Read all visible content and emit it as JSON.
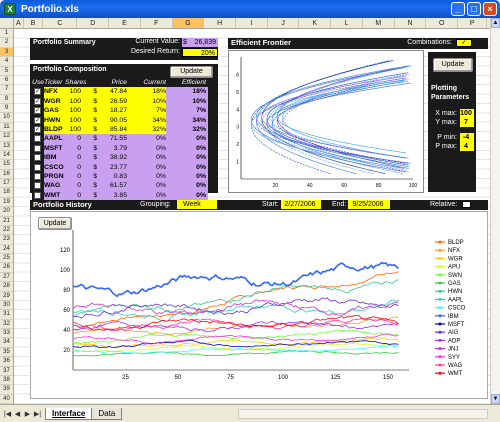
{
  "window": {
    "title": "Portfolio.xls"
  },
  "columns": [
    "A",
    "B",
    "C",
    "D",
    "E",
    "F",
    "G",
    "H",
    "I",
    "J",
    "K",
    "L",
    "M",
    "N",
    "O",
    "P"
  ],
  "selected_column": "G",
  "rows": [
    "1",
    "2",
    "3",
    "4",
    "5",
    "6",
    "7",
    "8",
    "9",
    "10",
    "11",
    "12",
    "13",
    "14",
    "15",
    "16",
    "17",
    "18",
    "19",
    "20",
    "21",
    "22",
    "23",
    "24",
    "25",
    "26",
    "27",
    "28",
    "29",
    "30",
    "31",
    "32",
    "33",
    "34",
    "35",
    "36",
    "37",
    "38",
    "39",
    "40"
  ],
  "selected_row": "3",
  "summary": {
    "title": "Portfolio Summary",
    "current_value_label": "Current Value:",
    "current_value_currency": "$",
    "current_value": "26,839",
    "desired_return_label": "Desired Return:",
    "desired_return": "20%"
  },
  "composition": {
    "title": "Portfolio Composition",
    "update_label": "Update",
    "headers": {
      "use": "Use",
      "ticker": "Ticker",
      "shares": "Shares",
      "price": "Price",
      "current": "Current",
      "efficient": "Efficient"
    },
    "rows": [
      {
        "checked": true,
        "ticker": "NFX",
        "shares": "100",
        "dollar": "$",
        "price": "47.84",
        "current": "18%",
        "efficient": "18%",
        "highlight": true
      },
      {
        "checked": true,
        "ticker": "WGR",
        "shares": "100",
        "dollar": "$",
        "price": "26.59",
        "current": "10%",
        "efficient": "10%",
        "highlight": true
      },
      {
        "checked": true,
        "ticker": "GAS",
        "shares": "100",
        "dollar": "$",
        "price": "18.27",
        "current": "7%",
        "efficient": "7%",
        "highlight": true
      },
      {
        "checked": true,
        "ticker": "HWN",
        "shares": "100",
        "dollar": "$",
        "price": "90.05",
        "current": "34%",
        "efficient": "34%",
        "highlight": true
      },
      {
        "checked": true,
        "ticker": "BLDP",
        "shares": "100",
        "dollar": "$",
        "price": "85.84",
        "current": "32%",
        "efficient": "32%",
        "highlight": true
      },
      {
        "checked": false,
        "ticker": "AAPL",
        "shares": "0",
        "dollar": "$",
        "price": "71.55",
        "current": "0%",
        "efficient": "0%",
        "highlight": false
      },
      {
        "checked": false,
        "ticker": "MSFT",
        "shares": "0",
        "dollar": "$",
        "price": "3.79",
        "current": "0%",
        "efficient": "0%",
        "highlight": false
      },
      {
        "checked": false,
        "ticker": "IBM",
        "shares": "0",
        "dollar": "$",
        "price": "38.92",
        "current": "0%",
        "efficient": "0%",
        "highlight": false
      },
      {
        "checked": false,
        "ticker": "CSCO",
        "shares": "0",
        "dollar": "$",
        "price": "23.77",
        "current": "0%",
        "efficient": "0%",
        "highlight": false
      },
      {
        "checked": false,
        "ticker": "PRGN",
        "shares": "0",
        "dollar": "$",
        "price": "0.83",
        "current": "0%",
        "efficient": "0%",
        "highlight": false
      },
      {
        "checked": false,
        "ticker": "WAG",
        "shares": "0",
        "dollar": "$",
        "price": "61.57",
        "current": "0%",
        "efficient": "0%",
        "highlight": false
      },
      {
        "checked": false,
        "ticker": "WMT",
        "shares": "0",
        "dollar": "$",
        "price": "3.85",
        "current": "0%",
        "efficient": "0%",
        "highlight": false
      }
    ]
  },
  "frontier": {
    "title": "Efficient Frontier",
    "combinations_label": "Combinations:",
    "combinations_checked": true
  },
  "plotting": {
    "update_label": "Update",
    "title_line1": "Plotting",
    "title_line2": "Parameters",
    "xmax_label": "X max:",
    "xmax": "100",
    "ymax_label": "Y max:",
    "ymax": "7",
    "pmin_label": "P min:",
    "pmin": "-4",
    "pmax_label": "P max:",
    "pmax": "4"
  },
  "history": {
    "title": "Portfolio History",
    "grouping_label": "Grouping:",
    "grouping": "Week",
    "start_label": "Start:",
    "start": "2/27/2006",
    "end_label": "End:",
    "end": "9/25/2006",
    "relative_label": "Relative:",
    "update_label": "Update"
  },
  "tabs": [
    "Interface",
    "Data"
  ],
  "active_tab": "Interface",
  "colors": {
    "panel": "#1a1a1a",
    "highlight": "#ffff00",
    "selection": "#c9a0f0"
  },
  "chart_data": [
    {
      "type": "scatter",
      "title": "",
      "xlim": [
        0,
        100
      ],
      "ylim": [
        0,
        7
      ],
      "x_ticks": [
        20,
        40,
        60,
        80,
        100
      ],
      "y_ticks": [
        1,
        2,
        3,
        4,
        5,
        6
      ],
      "grid": false,
      "series_count": 20
    },
    {
      "type": "line",
      "title": "",
      "xlim": [
        0,
        160
      ],
      "ylim": [
        0,
        140
      ],
      "x_ticks": [
        25,
        50,
        75,
        100,
        125,
        150
      ],
      "y_ticks": [
        20,
        40,
        60,
        80,
        100,
        120
      ],
      "legend": "right",
      "series": [
        {
          "name": "BLDP",
          "color": "#ff6600",
          "start": 40,
          "end": 100
        },
        {
          "name": "NFX",
          "color": "#ff9933",
          "start": 35,
          "end": 50
        },
        {
          "name": "WGR",
          "color": "#ffcc00",
          "start": 25,
          "end": 30
        },
        {
          "name": "APU",
          "color": "#ccff33",
          "start": 20,
          "end": 25
        },
        {
          "name": "SWN",
          "color": "#66ff33",
          "start": 30,
          "end": 38
        },
        {
          "name": "GAS",
          "color": "#33cc33",
          "start": 15,
          "end": 18
        },
        {
          "name": "HWN",
          "color": "#33cc99",
          "start": 55,
          "end": 90
        },
        {
          "name": "AAPL",
          "color": "#33cccc",
          "start": 55,
          "end": 65
        },
        {
          "name": "CSCO",
          "color": "#33ffff",
          "start": 18,
          "end": 22
        },
        {
          "name": "IBM",
          "color": "#3366ff",
          "start": 80,
          "end": 100
        },
        {
          "name": "MSFT",
          "color": "#0000cc",
          "start": 25,
          "end": 27
        },
        {
          "name": "AIG",
          "color": "#6633cc",
          "start": 60,
          "end": 68
        },
        {
          "name": "ADP",
          "color": "#9933ff",
          "start": 42,
          "end": 46
        },
        {
          "name": "JNJ",
          "color": "#cc33cc",
          "start": 60,
          "end": 64
        },
        {
          "name": "SYY",
          "color": "#ff33cc",
          "start": 30,
          "end": 32
        },
        {
          "name": "WAG",
          "color": "#ff3399",
          "start": 45,
          "end": 47
        },
        {
          "name": "WMT",
          "color": "#ff0000",
          "start": 45,
          "end": 48
        }
      ]
    }
  ]
}
